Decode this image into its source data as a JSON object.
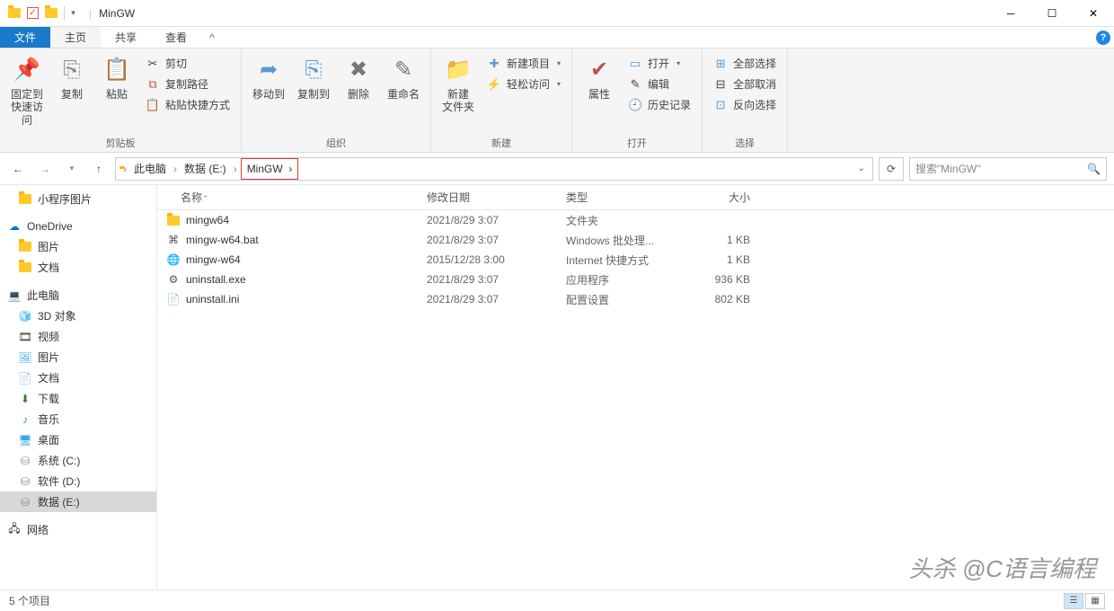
{
  "title": "MinGW",
  "tabs": {
    "file": "文件",
    "home": "主页",
    "share": "共享",
    "view": "查看"
  },
  "ribbon": {
    "clipboard": {
      "label": "剪贴板",
      "pin": "固定到\n快速访问",
      "copy": "复制",
      "paste": "粘贴",
      "cut": "剪切",
      "copypath": "复制路径",
      "pasteshortcut": "粘贴快捷方式"
    },
    "organize": {
      "label": "组织",
      "moveto": "移动到",
      "copyto": "复制到",
      "delete": "删除",
      "rename": "重命名"
    },
    "new": {
      "label": "新建",
      "newfolder": "新建\n文件夹",
      "newitem": "新建项目",
      "easyaccess": "轻松访问"
    },
    "open": {
      "label": "打开",
      "properties": "属性",
      "open": "打开",
      "edit": "编辑",
      "history": "历史记录"
    },
    "select": {
      "label": "选择",
      "selectall": "全部选择",
      "selectnone": "全部取消",
      "invert": "反向选择"
    }
  },
  "breadcrumb": {
    "pc": "此电脑",
    "drive": "数据 (E:)",
    "folder": "MinGW"
  },
  "search_placeholder": "搜索\"MinGW\"",
  "nav": {
    "miniprogram": "小程序图片",
    "onedrive": "OneDrive",
    "pictures": "图片",
    "documents": "文档",
    "thispc": "此电脑",
    "objects3d": "3D 对象",
    "videos": "视频",
    "pictures2": "图片",
    "documents2": "文档",
    "downloads": "下载",
    "music": "音乐",
    "desktop": "桌面",
    "sysc": "系统 (C:)",
    "softd": "软件 (D:)",
    "datae": "数据 (E:)",
    "network": "网络"
  },
  "columns": {
    "name": "名称",
    "date": "修改日期",
    "type": "类型",
    "size": "大小"
  },
  "files": [
    {
      "icon": "folder",
      "name": "mingw64",
      "date": "2021/8/29 3:07",
      "type": "文件夹",
      "size": ""
    },
    {
      "icon": "bat",
      "name": "mingw-w64.bat",
      "date": "2021/8/29 3:07",
      "type": "Windows 批处理...",
      "size": "1 KB"
    },
    {
      "icon": "url",
      "name": "mingw-w64",
      "date": "2015/12/28 3:00",
      "type": "Internet 快捷方式",
      "size": "1 KB"
    },
    {
      "icon": "exe",
      "name": "uninstall.exe",
      "date": "2021/8/29 3:07",
      "type": "应用程序",
      "size": "936 KB"
    },
    {
      "icon": "ini",
      "name": "uninstall.ini",
      "date": "2021/8/29 3:07",
      "type": "配置设置",
      "size": "802 KB"
    }
  ],
  "status": "5 个项目",
  "watermark": "头杀 @C语言编程"
}
